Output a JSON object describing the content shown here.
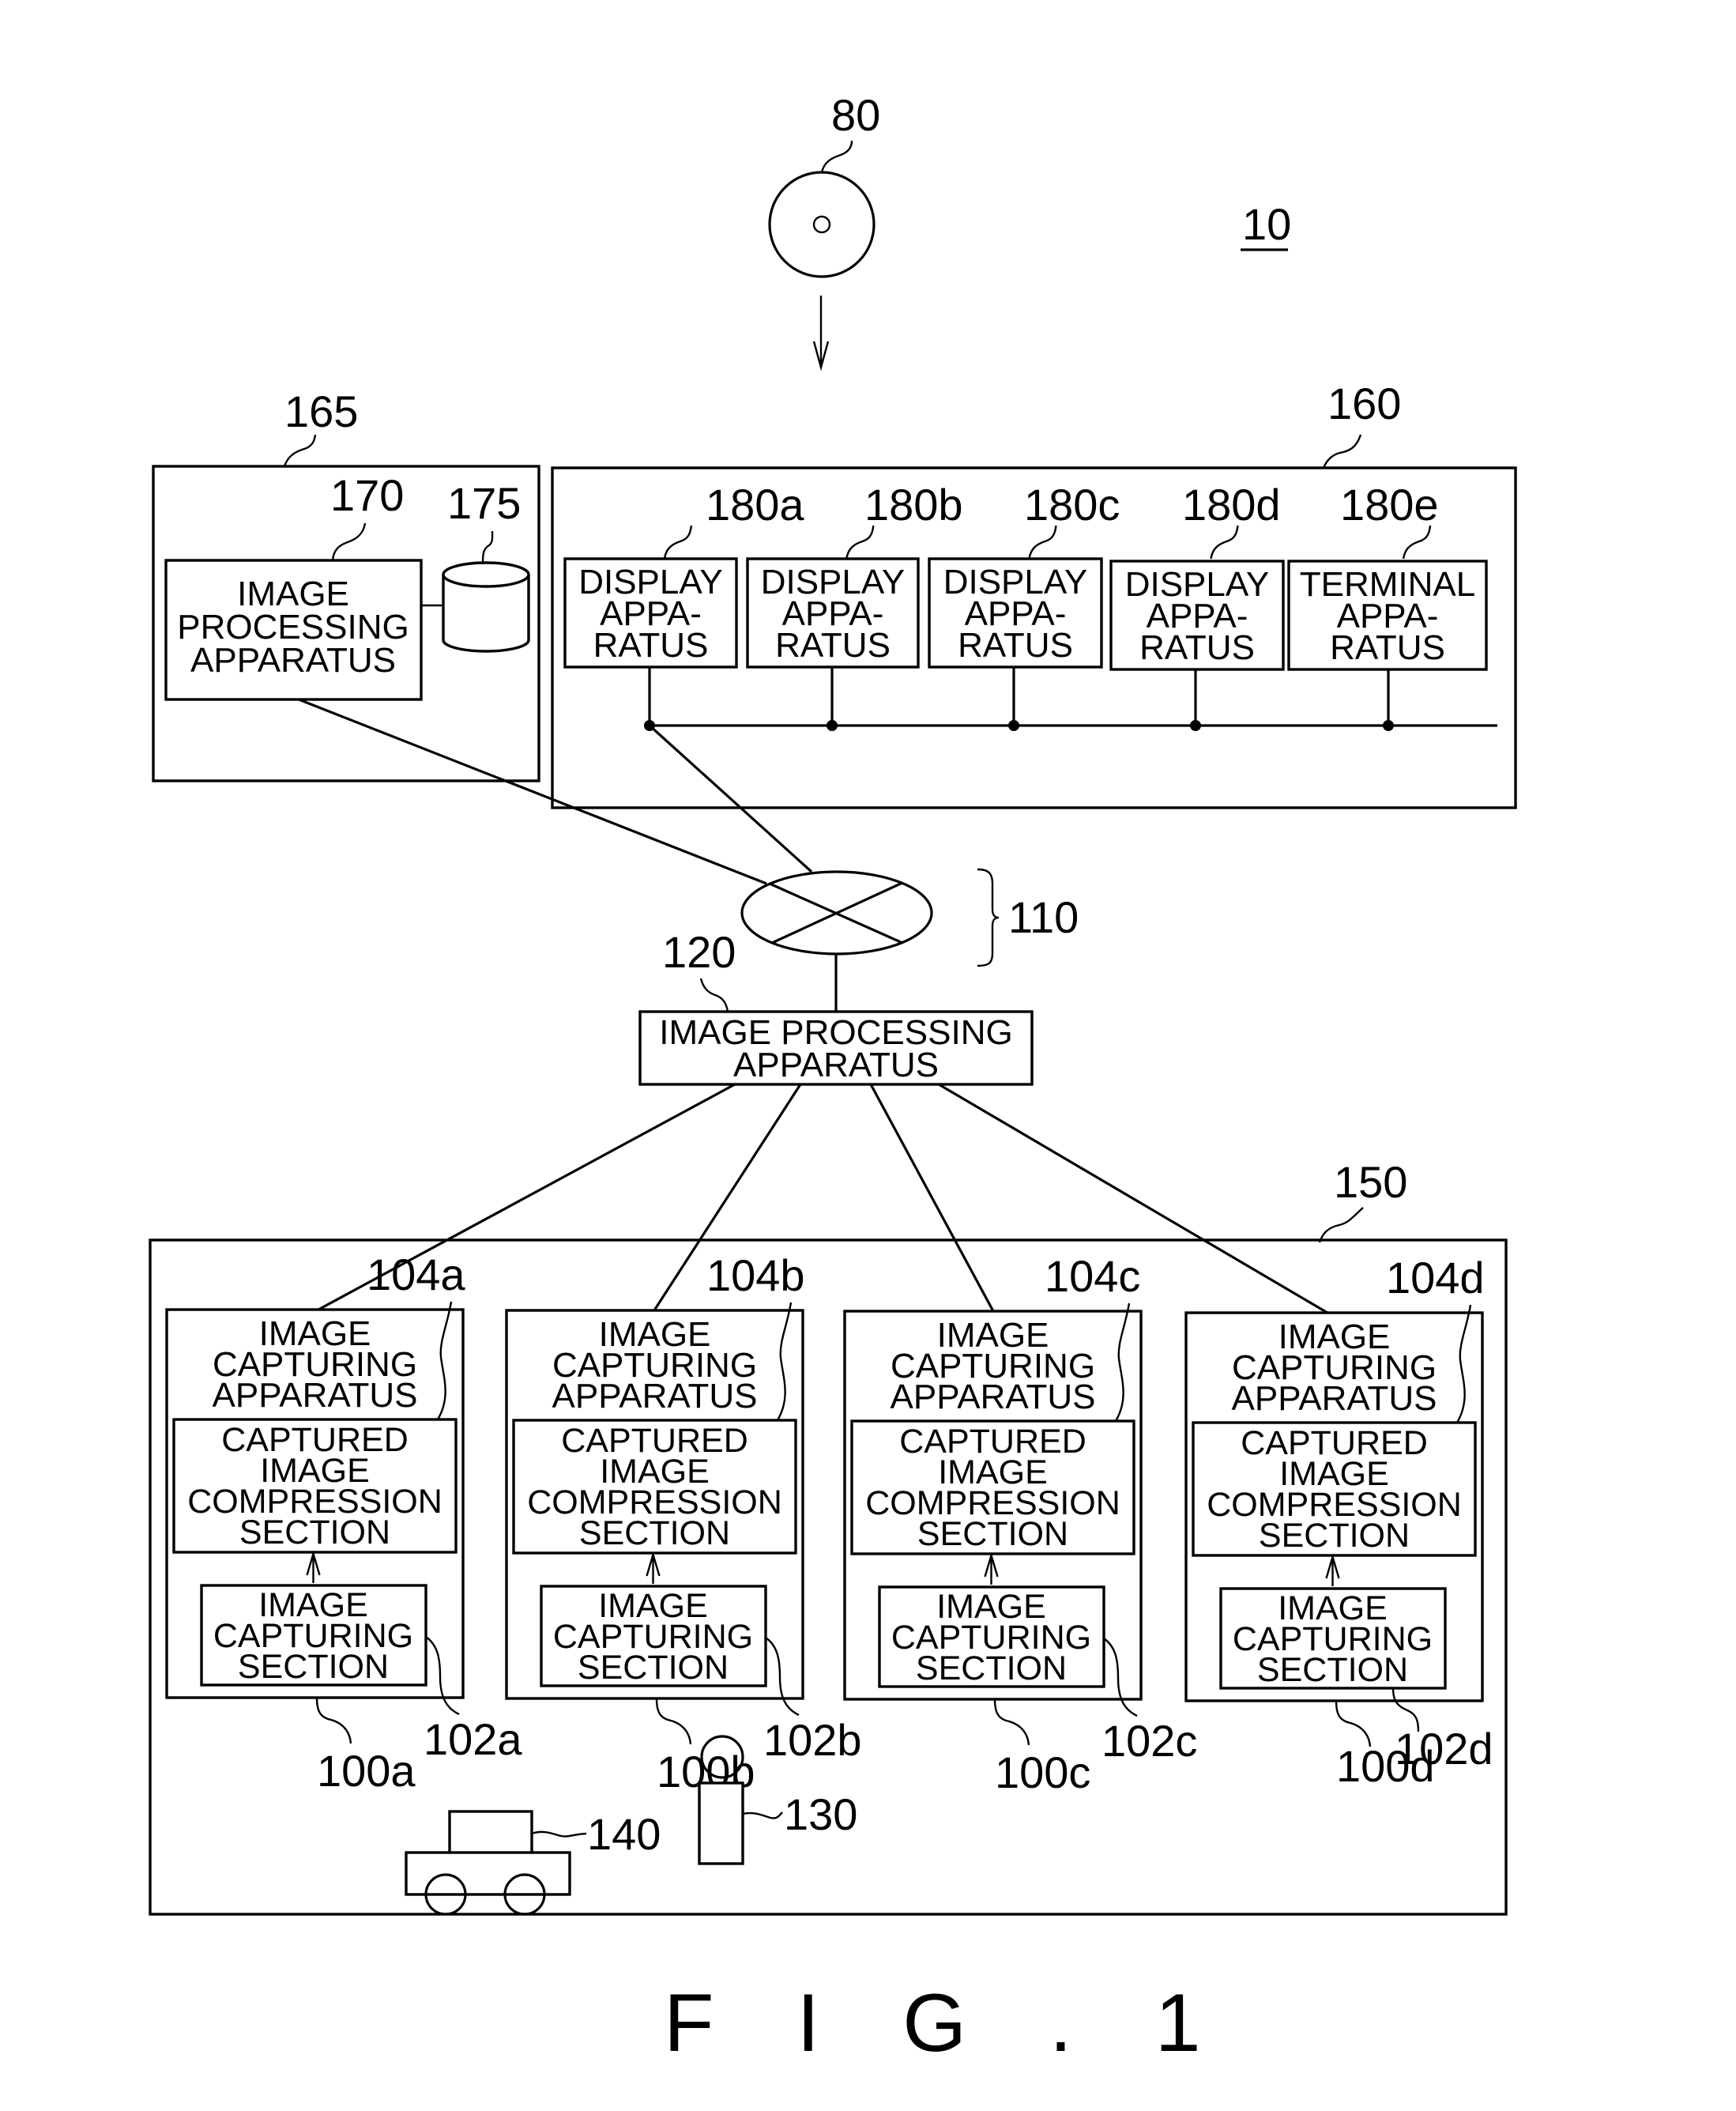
{
  "figure": {
    "title": "F I G . 1",
    "system_ref": "10"
  },
  "medium": {
    "ref": "80",
    "icon": "disc-icon"
  },
  "network": {
    "ref": "110",
    "icon": "network-cross-icon"
  },
  "center_processor": {
    "ref": "120",
    "lines": [
      "IMAGE PROCESSING",
      "APPARATUS"
    ]
  },
  "processing_site": {
    "ref": "165",
    "processor": {
      "ref": "170",
      "lines": [
        "IMAGE",
        "PROCESSING",
        "APPARATUS"
      ]
    },
    "storage": {
      "ref": "175",
      "icon": "database-cylinder-icon"
    }
  },
  "display_site": {
    "ref": "160",
    "devices": [
      {
        "ref": "180a",
        "lines": [
          "DISPLAY",
          "APPA-",
          "RATUS"
        ]
      },
      {
        "ref": "180b",
        "lines": [
          "DISPLAY",
          "APPA-",
          "RATUS"
        ]
      },
      {
        "ref": "180c",
        "lines": [
          "DISPLAY",
          "APPA-",
          "RATUS"
        ]
      },
      {
        "ref": "180d",
        "lines": [
          "DISPLAY",
          "APPA-",
          "RATUS"
        ]
      },
      {
        "ref": "180e",
        "lines": [
          "TERMINAL",
          "APPA-",
          "RATUS"
        ]
      }
    ]
  },
  "monitored_space": {
    "ref": "150",
    "cameras": [
      {
        "apparatus_ref": "100a",
        "compression_ref": "104a",
        "capture_ref": "102a",
        "apparatus_lines": [
          "IMAGE",
          "CAPTURING",
          "APPARATUS"
        ],
        "compression_lines": [
          "CAPTURED",
          "IMAGE",
          "COMPRESSION",
          "SECTION"
        ],
        "capture_lines": [
          "IMAGE",
          "CAPTURING",
          "SECTION"
        ]
      },
      {
        "apparatus_ref": "100b",
        "compression_ref": "104b",
        "capture_ref": "102b",
        "apparatus_lines": [
          "IMAGE",
          "CAPTURING",
          "APPARATUS"
        ],
        "compression_lines": [
          "CAPTURED",
          "IMAGE",
          "COMPRESSION",
          "SECTION"
        ],
        "capture_lines": [
          "IMAGE",
          "CAPTURING",
          "SECTION"
        ]
      },
      {
        "apparatus_ref": "100c",
        "compression_ref": "104c",
        "capture_ref": "102c",
        "apparatus_lines": [
          "IMAGE",
          "CAPTURING",
          "APPARATUS"
        ],
        "compression_lines": [
          "CAPTURED",
          "IMAGE",
          "COMPRESSION",
          "SECTION"
        ],
        "capture_lines": [
          "IMAGE",
          "CAPTURING",
          "SECTION"
        ]
      },
      {
        "apparatus_ref": "100d",
        "compression_ref": "104d",
        "capture_ref": "102d",
        "apparatus_lines": [
          "IMAGE",
          "CAPTURING",
          "APPARATUS"
        ],
        "compression_lines": [
          "CAPTURED",
          "IMAGE",
          "COMPRESSION",
          "SECTION"
        ],
        "capture_lines": [
          "IMAGE",
          "CAPTURING",
          "SECTION"
        ]
      }
    ],
    "person": {
      "ref": "130",
      "icon": "person-icon"
    },
    "vehicle": {
      "ref": "140",
      "icon": "car-icon"
    }
  }
}
